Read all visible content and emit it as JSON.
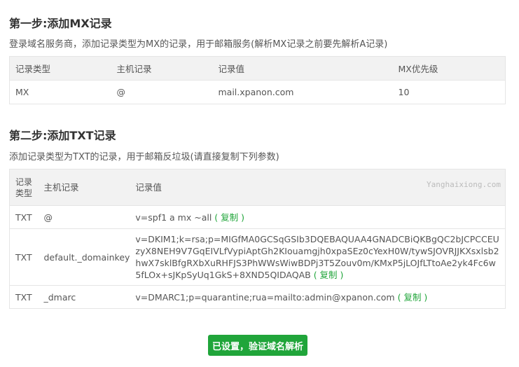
{
  "step1": {
    "title": "第一步:添加MX记录",
    "desc": "登录域名服务商，添加记录类型为MX的记录，用于邮箱服务(解析MX记录之前要先解析A记录)",
    "headers": [
      "记录类型",
      "主机记录",
      "记录值",
      "MX优先级"
    ],
    "row": [
      "MX",
      "@",
      "mail.xpanon.com",
      "10"
    ]
  },
  "step2": {
    "title": "第二步:添加TXT记录",
    "desc": "添加记录类型为TXT的记录，用于邮箱反垃圾(请直接复制下列参数)",
    "headers": [
      "记录类型",
      "主机记录",
      "记录值"
    ],
    "watermark": "Yanghaixiong.com",
    "copy_label": "( 复制 )",
    "rows": [
      {
        "type": "TXT",
        "host": "@",
        "value": "v=spf1 a mx ~all"
      },
      {
        "type": "TXT",
        "host": "default._domainkey",
        "value": "v=DKIM1;k=rsa;p=MIGfMA0GCSqGSIb3DQEBAQUAA4GNADCBiQKBgQC2bJCPCCEUzyX8NEH9V7GqEIVLfVypiAptGh2KIouamgjh0xpaSEz0cYexH0W/tywSJOVRJJKXsxlsb2hwX7sklBfgRXbXuRHFJS3PhWWsWiwBDPj3T5Zouv0m/KMxP5jLOJfLTtoAe2yk4Fc6w5fLOx+sJKpSyUq1GkS+8XND5QIDAQAB"
      },
      {
        "type": "TXT",
        "host": "_dmarc",
        "value": "v=DMARC1;p=quarantine;rua=mailto:admin@xpanon.com"
      }
    ]
  },
  "verify_button": "已设置，验证域名解析"
}
